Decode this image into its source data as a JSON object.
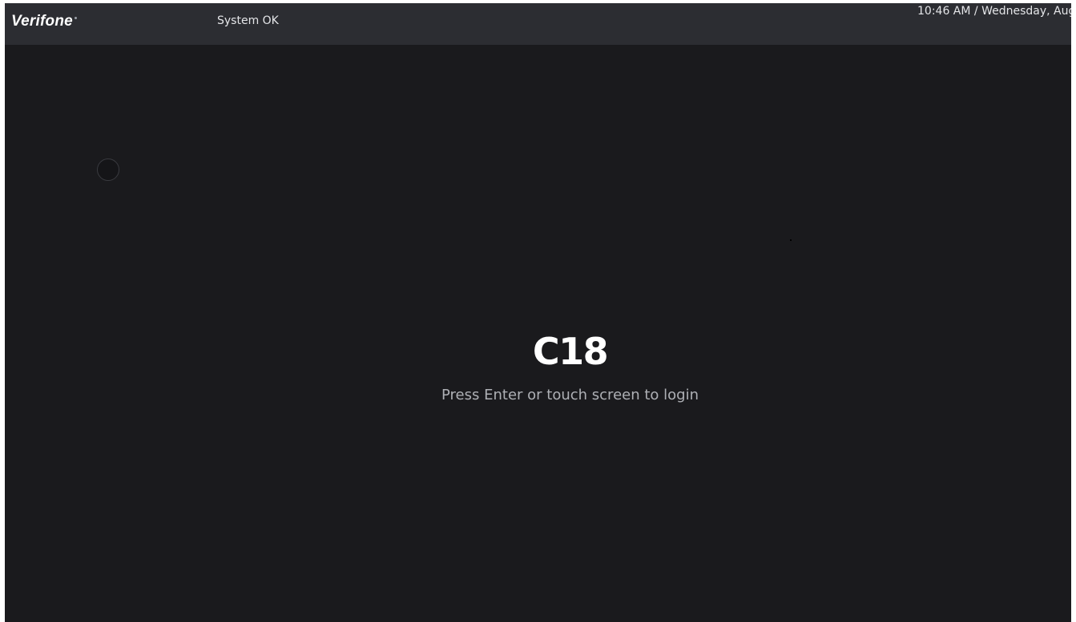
{
  "header": {
    "brand": "Verifone",
    "status": "System OK",
    "datetime": "10:46 AM / Wednesday, Aug"
  },
  "main": {
    "terminal_id": "C18",
    "prompt": "Press Enter or touch screen to login"
  },
  "colors": {
    "background": "#1a1a1d",
    "header_bar": "#2c2d32",
    "text_primary": "#ffffff",
    "text_secondary": "#aeb0b5"
  }
}
